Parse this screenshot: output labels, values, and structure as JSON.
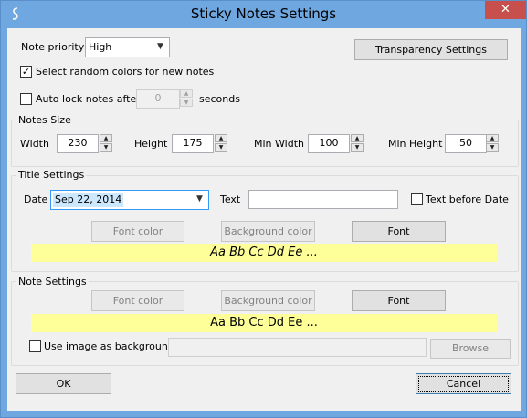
{
  "window": {
    "title": "Sticky Notes Settings",
    "icon": "sticky-note-icon",
    "close_glyph": "✕"
  },
  "top": {
    "note_priority_label": "Note priority",
    "note_priority_value": "High",
    "transparency_button": "Transparency Settings",
    "random_colors_label": "Select random colors for new notes",
    "random_colors_checked": true,
    "auto_lock_label": "Auto lock notes after",
    "auto_lock_checked": false,
    "auto_lock_value": "0",
    "seconds_label": "seconds"
  },
  "notes_size": {
    "title": "Notes Size",
    "width_label": "Width",
    "width_value": "230",
    "height_label": "Height",
    "height_value": "175",
    "min_width_label": "Min Width",
    "min_width_value": "100",
    "min_height_label": "Min Height",
    "min_height_value": "50"
  },
  "title_settings": {
    "title": "Title Settings",
    "date_label": "Date",
    "date_value": "Sep 22, 2014",
    "text_label": "Text",
    "text_value": "",
    "text_before_date_label": "Text before Date",
    "text_before_date_checked": false,
    "font_color_button": "Font color",
    "background_color_button": "Background color",
    "font_button": "Font",
    "preview_text": "Aa Bb Cc Dd Ee ...",
    "preview_color": "#ffff99"
  },
  "note_settings": {
    "title": "Note Settings",
    "font_color_button": "Font color",
    "background_color_button": "Background color",
    "font_button": "Font",
    "preview_text": "Aa Bb Cc Dd Ee ...",
    "preview_color": "#ffff99",
    "use_image_label": "Use image as background",
    "use_image_checked": false,
    "image_path_value": "",
    "browse_button": "Browse"
  },
  "footer": {
    "ok_button": "OK",
    "cancel_button": "Cancel"
  },
  "colors": {
    "title_bar": "#6fa7e0",
    "close_button": "#c7504c",
    "client_bg": "#f0f0f0"
  }
}
